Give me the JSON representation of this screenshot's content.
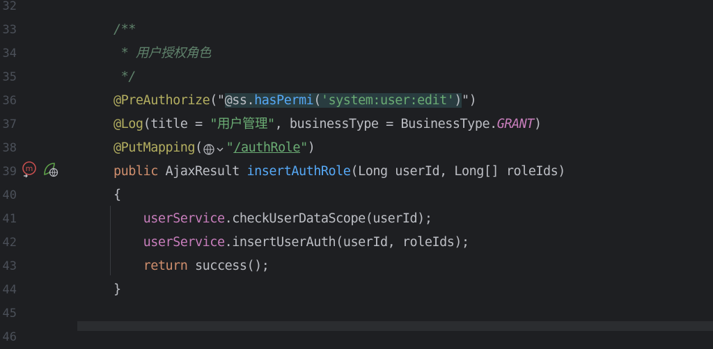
{
  "editor": {
    "lines": [
      {
        "num": "32",
        "parts": []
      },
      {
        "num": "33",
        "parts": [
          {
            "cls": "c-doc",
            "text": "/**"
          }
        ]
      },
      {
        "num": "34",
        "parts": [
          {
            "cls": "c-doc",
            "text": " * 用户授权角色"
          }
        ]
      },
      {
        "num": "35",
        "parts": [
          {
            "cls": "c-doc",
            "text": " */"
          }
        ]
      },
      {
        "num": "36",
        "parts": [
          {
            "cls": "c-anno",
            "text": "@PreAuthorize"
          },
          {
            "cls": "c-plain",
            "text": "(\""
          },
          {
            "cls": "c-spel-bg c-spel-obj",
            "text": "@ss."
          },
          {
            "cls": "c-spel-bg c-fn",
            "text": "hasPermi"
          },
          {
            "cls": "c-spel-bg c-plain",
            "text": "("
          },
          {
            "cls": "c-spel-bg c-spel-str",
            "text": "'system:user:edit'"
          },
          {
            "cls": "c-spel-bg c-plain",
            "text": ")"
          },
          {
            "cls": "c-plain",
            "text": "\")"
          }
        ]
      },
      {
        "num": "37",
        "parts": [
          {
            "cls": "c-anno",
            "text": "@Log"
          },
          {
            "cls": "c-plain",
            "text": "(title = "
          },
          {
            "cls": "c-str",
            "text": "\"用户管理\""
          },
          {
            "cls": "c-plain",
            "text": ", businessType = BusinessType."
          },
          {
            "cls": "c-const",
            "text": "GRANT"
          },
          {
            "cls": "c-plain",
            "text": ")"
          }
        ]
      },
      {
        "num": "38",
        "parts": [
          {
            "cls": "c-anno",
            "text": "@PutMapping"
          },
          {
            "cls": "c-plain",
            "text": "("
          },
          {
            "cls": "globe",
            "text": ""
          },
          {
            "cls": "c-str",
            "text": "\""
          },
          {
            "cls": "c-link",
            "text": "/authRole"
          },
          {
            "cls": "c-str",
            "text": "\""
          },
          {
            "cls": "c-plain",
            "text": ")"
          }
        ]
      },
      {
        "num": "39",
        "parts": [
          {
            "cls": "c-kw",
            "text": "public "
          },
          {
            "cls": "c-plain",
            "text": "AjaxResult "
          },
          {
            "cls": "c-fn",
            "text": "insertAuthRole"
          },
          {
            "cls": "c-plain",
            "text": "(Long userId, Long[] roleIds)"
          }
        ]
      },
      {
        "num": "40",
        "parts": [
          {
            "cls": "c-plain",
            "text": "{"
          }
        ]
      },
      {
        "num": "41",
        "parts": [
          {
            "cls": "c-plain",
            "text": "    "
          },
          {
            "cls": "c-field",
            "text": "userService"
          },
          {
            "cls": "c-plain",
            "text": ".checkUserDataScope(userId);"
          }
        ]
      },
      {
        "num": "42",
        "parts": [
          {
            "cls": "c-plain",
            "text": "    "
          },
          {
            "cls": "c-field",
            "text": "userService"
          },
          {
            "cls": "c-plain",
            "text": ".insertUserAuth(userId, roleIds);"
          }
        ]
      },
      {
        "num": "43",
        "parts": [
          {
            "cls": "c-plain",
            "text": "    "
          },
          {
            "cls": "c-kw",
            "text": "return "
          },
          {
            "cls": "c-plain",
            "text": "success();"
          }
        ]
      },
      {
        "num": "44",
        "parts": [
          {
            "cls": "c-plain",
            "text": "}"
          }
        ]
      },
      {
        "num": "45",
        "parts": []
      },
      {
        "num": "46",
        "parts": []
      }
    ]
  },
  "gutter_icons": [
    {
      "line": "39",
      "name": "override-method-icon"
    },
    {
      "line": "39",
      "name": "web-endpoint-icon"
    }
  ],
  "colors": {
    "background": "#1e1f22",
    "line_number": "#4b5059",
    "annotation": "#b3ae60",
    "string": "#6aab73",
    "keyword": "#cf8e6d",
    "function": "#56a8f5",
    "field": "#c77dbb",
    "doc_comment": "#5f826b"
  }
}
